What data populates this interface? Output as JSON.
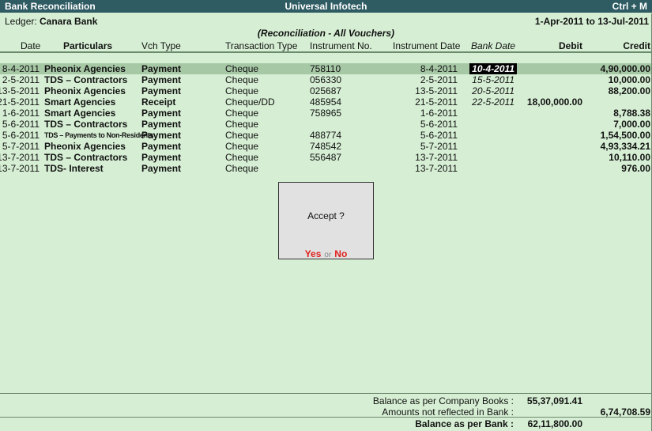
{
  "titlebar": {
    "left": "Bank Reconciliation",
    "center": "Universal Infotech",
    "right": "Ctrl + M"
  },
  "ledger": {
    "label": "Ledger:",
    "name": "Canara Bank"
  },
  "period": "1-Apr-2011 to 13-Jul-2011",
  "subtitle": "(Reconciliation - All Vouchers)",
  "columns": {
    "date": "Date",
    "particulars": "Particulars",
    "vch_type": "Vch Type",
    "transaction_type": "Transaction Type",
    "instrument_no": "Instrument No.",
    "instrument_date": "Instrument Date",
    "bank_date": "Bank Date",
    "debit": "Debit",
    "credit": "Credit"
  },
  "rows": [
    {
      "date": "8-4-2011",
      "particulars": "Pheonix Agencies",
      "vch_type": "Payment",
      "transaction_type": "Cheque",
      "instrument_no": "758110",
      "instrument_date": "8-4-2011",
      "bank_date": "10-4-2011",
      "debit": "",
      "credit": "4,90,000.00"
    },
    {
      "date": "2-5-2011",
      "particulars": "TDS – Contractors",
      "vch_type": "Payment",
      "transaction_type": "Cheque",
      "instrument_no": "056330",
      "instrument_date": "2-5-2011",
      "bank_date": "15-5-2011",
      "debit": "",
      "credit": "10,000.00"
    },
    {
      "date": "13-5-2011",
      "particulars": "Pheonix Agencies",
      "vch_type": "Payment",
      "transaction_type": "Cheque",
      "instrument_no": "025687",
      "instrument_date": "13-5-2011",
      "bank_date": "20-5-2011",
      "debit": "",
      "credit": "88,200.00"
    },
    {
      "date": "21-5-2011",
      "particulars": "Smart Agencies",
      "vch_type": "Receipt",
      "transaction_type": "Cheque/DD",
      "instrument_no": "485954",
      "instrument_date": "21-5-2011",
      "bank_date": "22-5-2011",
      "debit": "18,00,000.00",
      "credit": ""
    },
    {
      "date": "1-6-2011",
      "particulars": "Smart Agencies",
      "vch_type": "Payment",
      "transaction_type": "Cheque",
      "instrument_no": "758965",
      "instrument_date": "1-6-2011",
      "bank_date": "",
      "debit": "",
      "credit": "8,788.38"
    },
    {
      "date": "5-6-2011",
      "particulars": "TDS – Contractors",
      "vch_type": "Payment",
      "transaction_type": "Cheque",
      "instrument_no": "",
      "instrument_date": "5-6-2011",
      "bank_date": "",
      "debit": "",
      "credit": "7,000.00"
    },
    {
      "date": "5-6-2011",
      "particulars": "TDS – Payments to Non-Residents",
      "vch_type": "Payment",
      "transaction_type": "Cheque",
      "instrument_no": "488774",
      "instrument_date": "5-6-2011",
      "bank_date": "",
      "debit": "",
      "credit": "1,54,500.00"
    },
    {
      "date": "5-7-2011",
      "particulars": "Pheonix Agencies",
      "vch_type": "Payment",
      "transaction_type": "Cheque",
      "instrument_no": "748542",
      "instrument_date": "5-7-2011",
      "bank_date": "",
      "debit": "",
      "credit": "4,93,334.21"
    },
    {
      "date": "13-7-2011",
      "particulars": "TDS – Contractors",
      "vch_type": "Payment",
      "transaction_type": "Cheque",
      "instrument_no": "556487",
      "instrument_date": "13-7-2011",
      "bank_date": "",
      "debit": "",
      "credit": "10,110.00"
    },
    {
      "date": "13-7-2011",
      "particulars": "TDS- Interest",
      "vch_type": "Payment",
      "transaction_type": "Cheque",
      "instrument_no": "",
      "instrument_date": "13-7-2011",
      "bank_date": "",
      "debit": "",
      "credit": "976.00"
    }
  ],
  "dialog": {
    "question": "Accept ?",
    "yes": "Yes",
    "or": "or",
    "no": "No"
  },
  "footer": {
    "company_books_label": "Balance as per Company Books :",
    "company_books_debit": "55,37,091.41",
    "not_reflected_label": "Amounts not reflected in Bank :",
    "not_reflected_credit": "6,74,708.59",
    "bank_balance_label": "Balance as per Bank :",
    "bank_balance_debit": "62,11,800.00"
  },
  "colors": {
    "background": "#d6efd4",
    "titlebar": "#2f5b63",
    "selected_row": "#a6c8a5",
    "dialog_action": "#e0211c"
  }
}
